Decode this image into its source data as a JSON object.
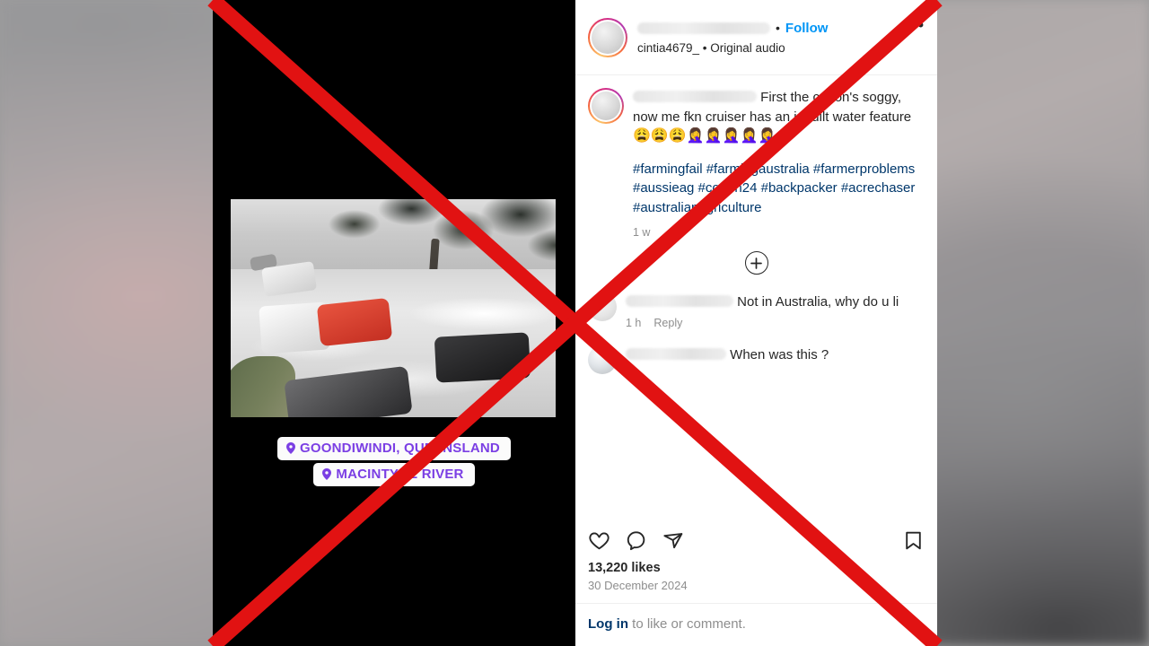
{
  "post": {
    "header": {
      "username_redacted": true,
      "separator": "•",
      "follow_label": "Follow",
      "audio_line": "cintia4679_ • Original audio",
      "more_options_label": "•••"
    },
    "caption": {
      "text": "First the cotton's soggy, now me fkn cruiser has an inbuilt water feature",
      "emojis": "😩😩😩🤦‍♀️🤦‍♀️🤦‍♀️🤦‍♀️🤦‍♀️",
      "hashtags": "#farmingfail #farmingaustralia #farmerproblems #aussieag #cotton24 #backpacker #acrechaser #australianagriculture",
      "time_ago": "1 w"
    },
    "load_more_label": "+",
    "comments": [
      {
        "text": "Not in Australia, why do u li",
        "time_ago": "1 h",
        "reply_label": "Reply"
      },
      {
        "text": "When was this ?",
        "time_ago": "",
        "reply_label": ""
      }
    ],
    "actions": {
      "like": "like-icon",
      "comment": "comment-icon",
      "share": "share-icon",
      "save": "bookmark-icon"
    },
    "likes": "13,220 likes",
    "date": "30 December 2024",
    "login": {
      "link": "Log in",
      "rest": " to like or comment."
    }
  },
  "media": {
    "stickers": [
      {
        "icon": "location-pin-icon",
        "label": "GOONDIWINDI, QUEENSLAND"
      },
      {
        "icon": "location-pin-icon",
        "label": "MACINTYRE RIVER"
      }
    ],
    "scene_description": "flooded street with cars submerged in fast-moving brown floodwater"
  },
  "overlay": {
    "mark": "red-cross-out",
    "color": "#e11212",
    "stroke_width": 16
  },
  "colors": {
    "instagram_blue": "#0095f6",
    "link_blue": "#00376b",
    "sticker_purple": "#7b3fe4",
    "text_primary": "#262626",
    "text_muted": "#8e8e8e",
    "cross_red": "#e11212"
  }
}
